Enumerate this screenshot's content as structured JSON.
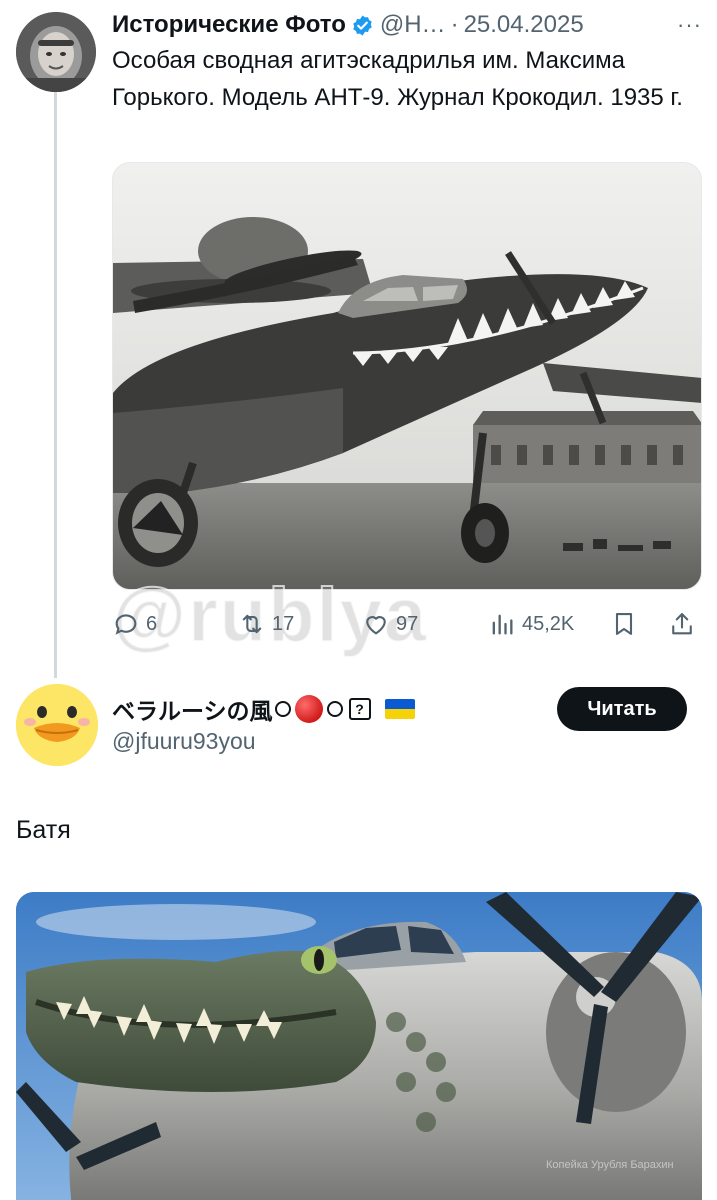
{
  "quoted_tweet": {
    "author_name": "Исторические Фото",
    "handle": "@Н…",
    "separator": "·",
    "date": "25.04.2025",
    "more_label": "···",
    "text": "Особая сводная агитэскадрилья им. Максима Горького. Модель АНТ-9. Журнал Крокодил. 1935 г.",
    "image_icon": "plane-photo",
    "stats": {
      "replies": "6",
      "retweets": "17",
      "likes": "97",
      "views": "45,2K"
    }
  },
  "watermark": "@rublya",
  "reply_tweet": {
    "author_name": "ベラルーシの風",
    "question_glyph": "?",
    "handle": "@jfuuru93you",
    "follow_label": "Читать",
    "text": "Батя",
    "image_icon": "crocodile-plane-image",
    "image_caption": "Копейка Урубля Барахин"
  },
  "colors": {
    "text": "#0f1419",
    "muted": "#536471",
    "verified": "#1d9bf0",
    "button_bg": "#0f1419",
    "avatar_duck": "#fde566"
  }
}
